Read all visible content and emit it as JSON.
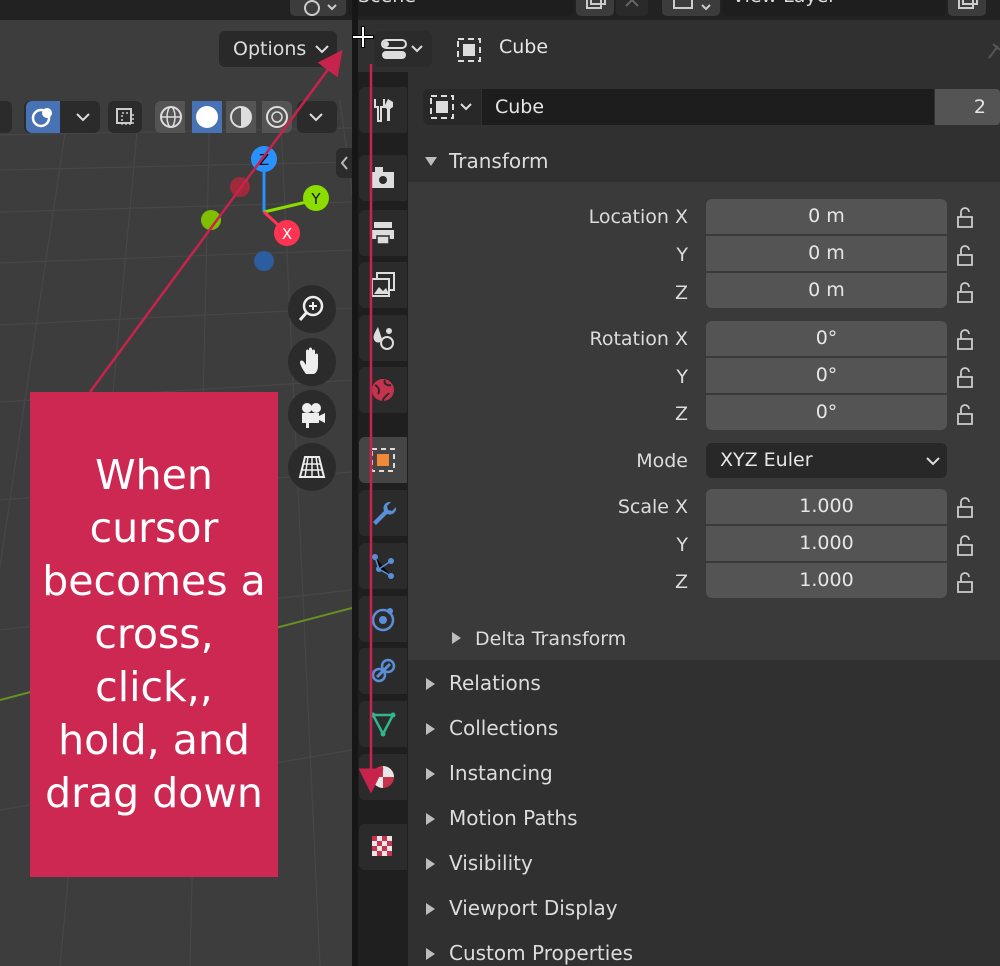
{
  "topbar": {
    "scene_label": "Scene",
    "view_layer_label": "View Layer"
  },
  "viewport": {
    "options_label": "Options",
    "gizmo": {
      "z": "Z",
      "y": "Y",
      "x": "X"
    },
    "colors": {
      "x": "#ff3352",
      "y": "#8bdc00",
      "z": "#2890ff",
      "grid_line": "#6a8f24"
    }
  },
  "properties": {
    "header_title": "Cube",
    "object_name": "Cube",
    "users_count": "2",
    "transform": {
      "title": "Transform",
      "location": {
        "label": "Location X",
        "y_label": "Y",
        "z_label": "Z",
        "values": [
          "0 m",
          "0 m",
          "0 m"
        ]
      },
      "rotation": {
        "label": "Rotation X",
        "y_label": "Y",
        "z_label": "Z",
        "values": [
          "0°",
          "0°",
          "0°"
        ]
      },
      "mode": {
        "label": "Mode",
        "value": "XYZ Euler"
      },
      "scale": {
        "label": "Scale X",
        "y_label": "Y",
        "z_label": "Z",
        "values": [
          "1.000",
          "1.000",
          "1.000"
        ]
      },
      "delta_title": "Delta Transform"
    },
    "panels": [
      "Relations",
      "Collections",
      "Instancing",
      "Motion Paths",
      "Visibility",
      "Viewport Display",
      "Custom Properties"
    ],
    "tabs": [
      "tool",
      "render",
      "output",
      "view-layer",
      "scene",
      "world",
      "object",
      "modifiers",
      "particles",
      "physics",
      "constraints",
      "data",
      "material",
      "texture"
    ],
    "active_tab": "object"
  },
  "annotation": {
    "text": "When cursor becomes a cross, click,, hold, and drag down",
    "color": "#cd2852",
    "arrow_color": "#c8234d"
  }
}
